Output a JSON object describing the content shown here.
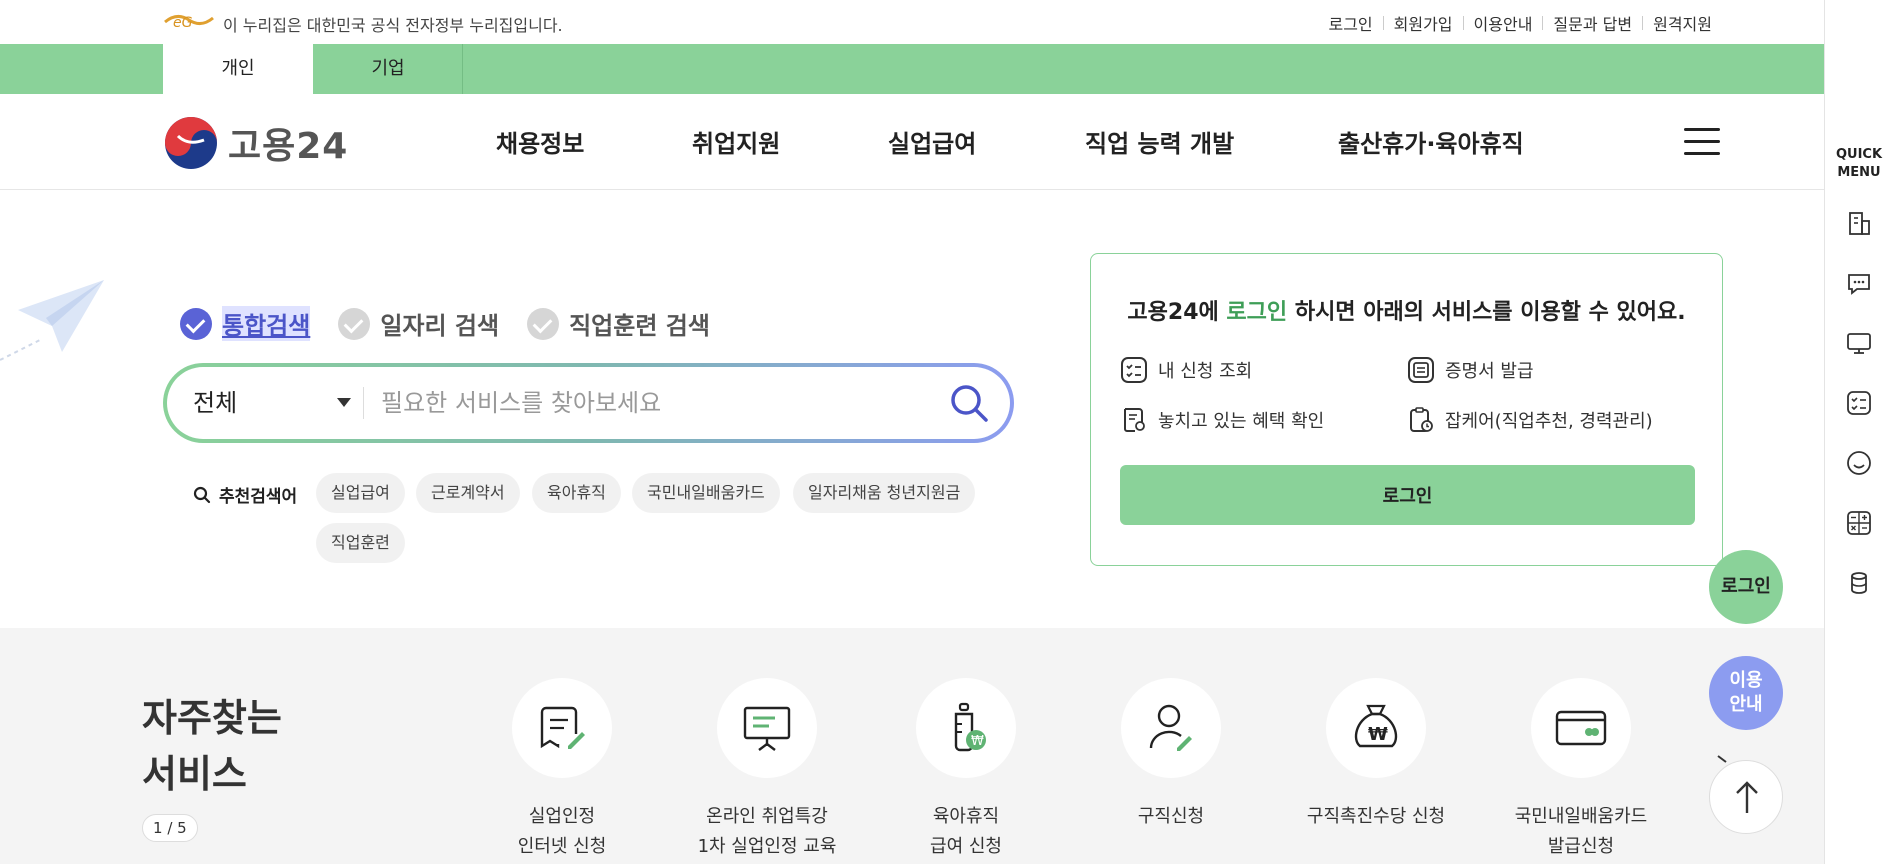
{
  "gov_bar": {
    "text": "이 누리집은 대한민국 공식 전자정부 누리집입니다.",
    "links": [
      "로그인",
      "회원가입",
      "이용안내",
      "질문과 답변",
      "원격지원"
    ]
  },
  "user_tabs": [
    "개인",
    "기업"
  ],
  "brand": {
    "name": "고용24"
  },
  "gnb": [
    "채용정보",
    "취업지원",
    "실업급여",
    "직업 능력 개발",
    "출산휴가·육아휴직"
  ],
  "search": {
    "options": [
      "통합검색",
      "일자리 검색",
      "직업훈련 검색"
    ],
    "scope": "전체",
    "placeholder": "필요한 서비스를 찾아보세요",
    "recommend_label": "추천검색어",
    "keywords": [
      "실업급여",
      "근로계약서",
      "육아휴직",
      "국민내일배움카드",
      "일자리채움 청년지원금",
      "직업훈련"
    ]
  },
  "login_card": {
    "title_pre": "고용24에",
    "title_hl": "로그인",
    "title_post": "하시면 아래의 서비스를 이용할 수 있어요.",
    "items": [
      "내 신청 조회",
      "증명서 발급",
      "놓치고 있는 혜택 확인",
      "잡케어(직업추천, 경력관리)"
    ],
    "button": "로그인"
  },
  "frequent": {
    "title_line1": "자주찾는",
    "title_line2": "서비스",
    "pager_current": "1",
    "pager_total": "/ 5",
    "services": [
      {
        "line1": "실업인정",
        "line2": "인터넷 신청",
        "icon": "document-pen-icon"
      },
      {
        "line1": "온라인 취업특강",
        "line2": "1차 실업인정 교육",
        "icon": "presentation-board-icon"
      },
      {
        "line1": "육아휴직",
        "line2": "급여 신청",
        "icon": "baby-bottle-won-icon"
      },
      {
        "line1": "구직신청",
        "line2": "",
        "icon": "person-pen-icon"
      },
      {
        "line1": "구직촉진수당 신청",
        "line2": "",
        "icon": "money-bag-icon"
      },
      {
        "line1": "국민내일배움카드",
        "line2": "발급신청",
        "icon": "card-icon"
      }
    ]
  },
  "quick_menu": {
    "title_line1": "QUICK",
    "title_line2": "MENU"
  },
  "floating": {
    "login": "로그인",
    "guide_line1": "이용",
    "guide_line2": "안내"
  },
  "colors": {
    "brand_green": "#8ad299",
    "accent_purple": "#8c9cf0",
    "check_active": "#5a63d6"
  }
}
